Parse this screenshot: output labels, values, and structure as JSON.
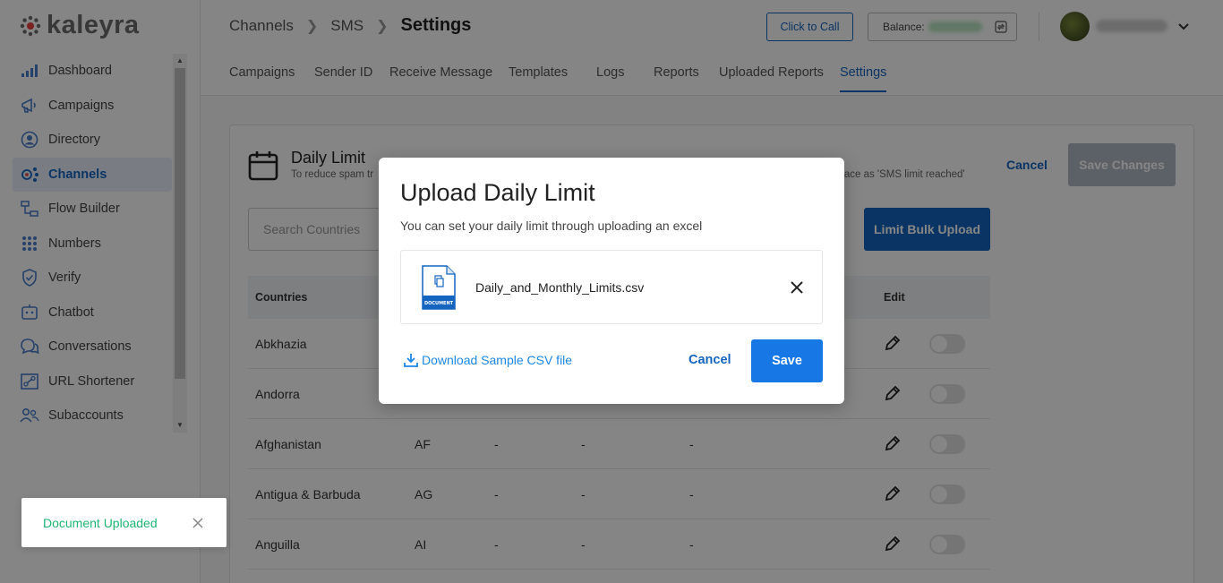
{
  "brand": {
    "name": "kaleyra",
    "accent": "#1565c0",
    "logo_color": "#e8413d"
  },
  "sidebar": {
    "items": [
      {
        "label": "Dashboard",
        "icon": "bar-chart-icon"
      },
      {
        "label": "Campaigns",
        "icon": "megaphone-icon"
      },
      {
        "label": "Directory",
        "icon": "user-circle-icon"
      },
      {
        "label": "Channels",
        "icon": "channels-icon",
        "active": true
      },
      {
        "label": "Flow Builder",
        "icon": "flow-icon"
      },
      {
        "label": "Numbers",
        "icon": "grid-dots-icon"
      },
      {
        "label": "Verify",
        "icon": "shield-check-icon"
      },
      {
        "label": "Chatbot",
        "icon": "chatbot-icon"
      },
      {
        "label": "Conversations",
        "icon": "chat-bubbles-icon"
      },
      {
        "label": "URL Shortener",
        "icon": "link-icon"
      },
      {
        "label": "Subaccounts",
        "icon": "users-icon"
      }
    ]
  },
  "header": {
    "breadcrumb": [
      "Channels",
      "SMS",
      "Settings"
    ],
    "click_to_call": "Click to Call",
    "balance_label": "Balance:"
  },
  "tabs": [
    {
      "label": "Campaigns"
    },
    {
      "label": "Sender ID"
    },
    {
      "label": "Receive Message"
    },
    {
      "label": "Templates"
    },
    {
      "label": "Logs"
    },
    {
      "label": "Reports"
    },
    {
      "label": "Uploaded Reports"
    },
    {
      "label": "Settings",
      "active": true
    }
  ],
  "card": {
    "title": "Daily Limit",
    "subtitle_start": "To reduce spam tr",
    "subtitle_end": "race as 'SMS limit reached'",
    "cancel": "Cancel",
    "save_changes": "Save Changes",
    "search_placeholder": "Search Countries",
    "bulk_upload": "Limit Bulk Upload",
    "columns": {
      "countries": "Countries",
      "edit": "Edit"
    },
    "rows": [
      {
        "country": "Abkhazia",
        "code": "",
        "a": "",
        "b": "",
        "c": ""
      },
      {
        "country": "Andorra",
        "code": "",
        "a": "",
        "b": "",
        "c": ""
      },
      {
        "country": "Afghanistan",
        "code": "AF",
        "a": "-",
        "b": "-",
        "c": "-"
      },
      {
        "country": "Antigua & Barbuda",
        "code": "AG",
        "a": "-",
        "b": "-",
        "c": "-"
      },
      {
        "country": "Anguilla",
        "code": "AI",
        "a": "-",
        "b": "-",
        "c": "-"
      }
    ]
  },
  "modal": {
    "title": "Upload Daily Limit",
    "description": "You can set your daily limit through uploading an excel",
    "file_name": "Daily_and_Monthly_Limits.csv",
    "file_icon_label": "DOCUMENT",
    "download_link": "Download Sample CSV file",
    "cancel": "Cancel",
    "save": "Save"
  },
  "toast": {
    "message": "Document Uploaded",
    "color": "#22b573"
  }
}
